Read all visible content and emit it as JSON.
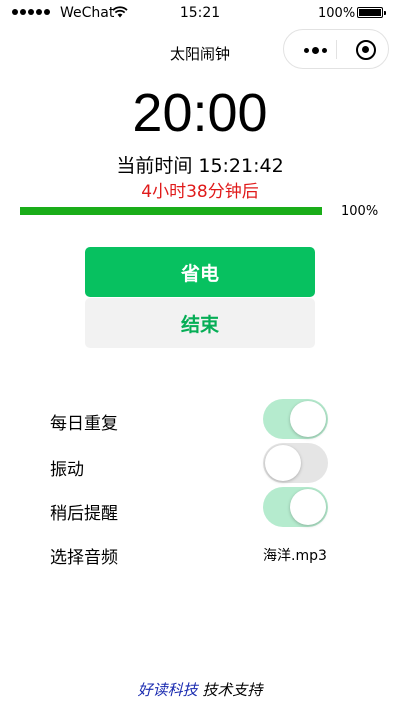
{
  "status_bar": {
    "carrier": "WeChat",
    "time": "15:21",
    "battery_percent": "100%",
    "battery_level": 1.0,
    "icons": [
      "signal-dots-icon",
      "wifi-icon",
      "battery-icon"
    ]
  },
  "nav": {
    "title": "太阳闹钟",
    "icons": [
      "more-icon",
      "close-miniprogram-icon"
    ]
  },
  "alarm": {
    "time": "20:00",
    "current_time": "当前时间 15:21:42",
    "remaining": "4小时38分钟后",
    "progress": 1.0,
    "progress_label": "100%"
  },
  "buttons": {
    "power_save": "省电",
    "end": "结束"
  },
  "settings": [
    {
      "label": "每日重复",
      "checked": true
    },
    {
      "label": "振动",
      "checked": false
    },
    {
      "label": "稍后提醒",
      "checked": true
    }
  ],
  "audio": {
    "label": "选择音频",
    "value": "海洋.mp3"
  },
  "footer": {
    "link": "好读科技",
    "text": "技术支持"
  },
  "colors": {
    "accent_green": "#07c160",
    "progress_green": "#1aad19",
    "switch_on": "#b5ebce",
    "remaining_red": "#e01a1a",
    "footer_link": "#1a2bb0"
  }
}
